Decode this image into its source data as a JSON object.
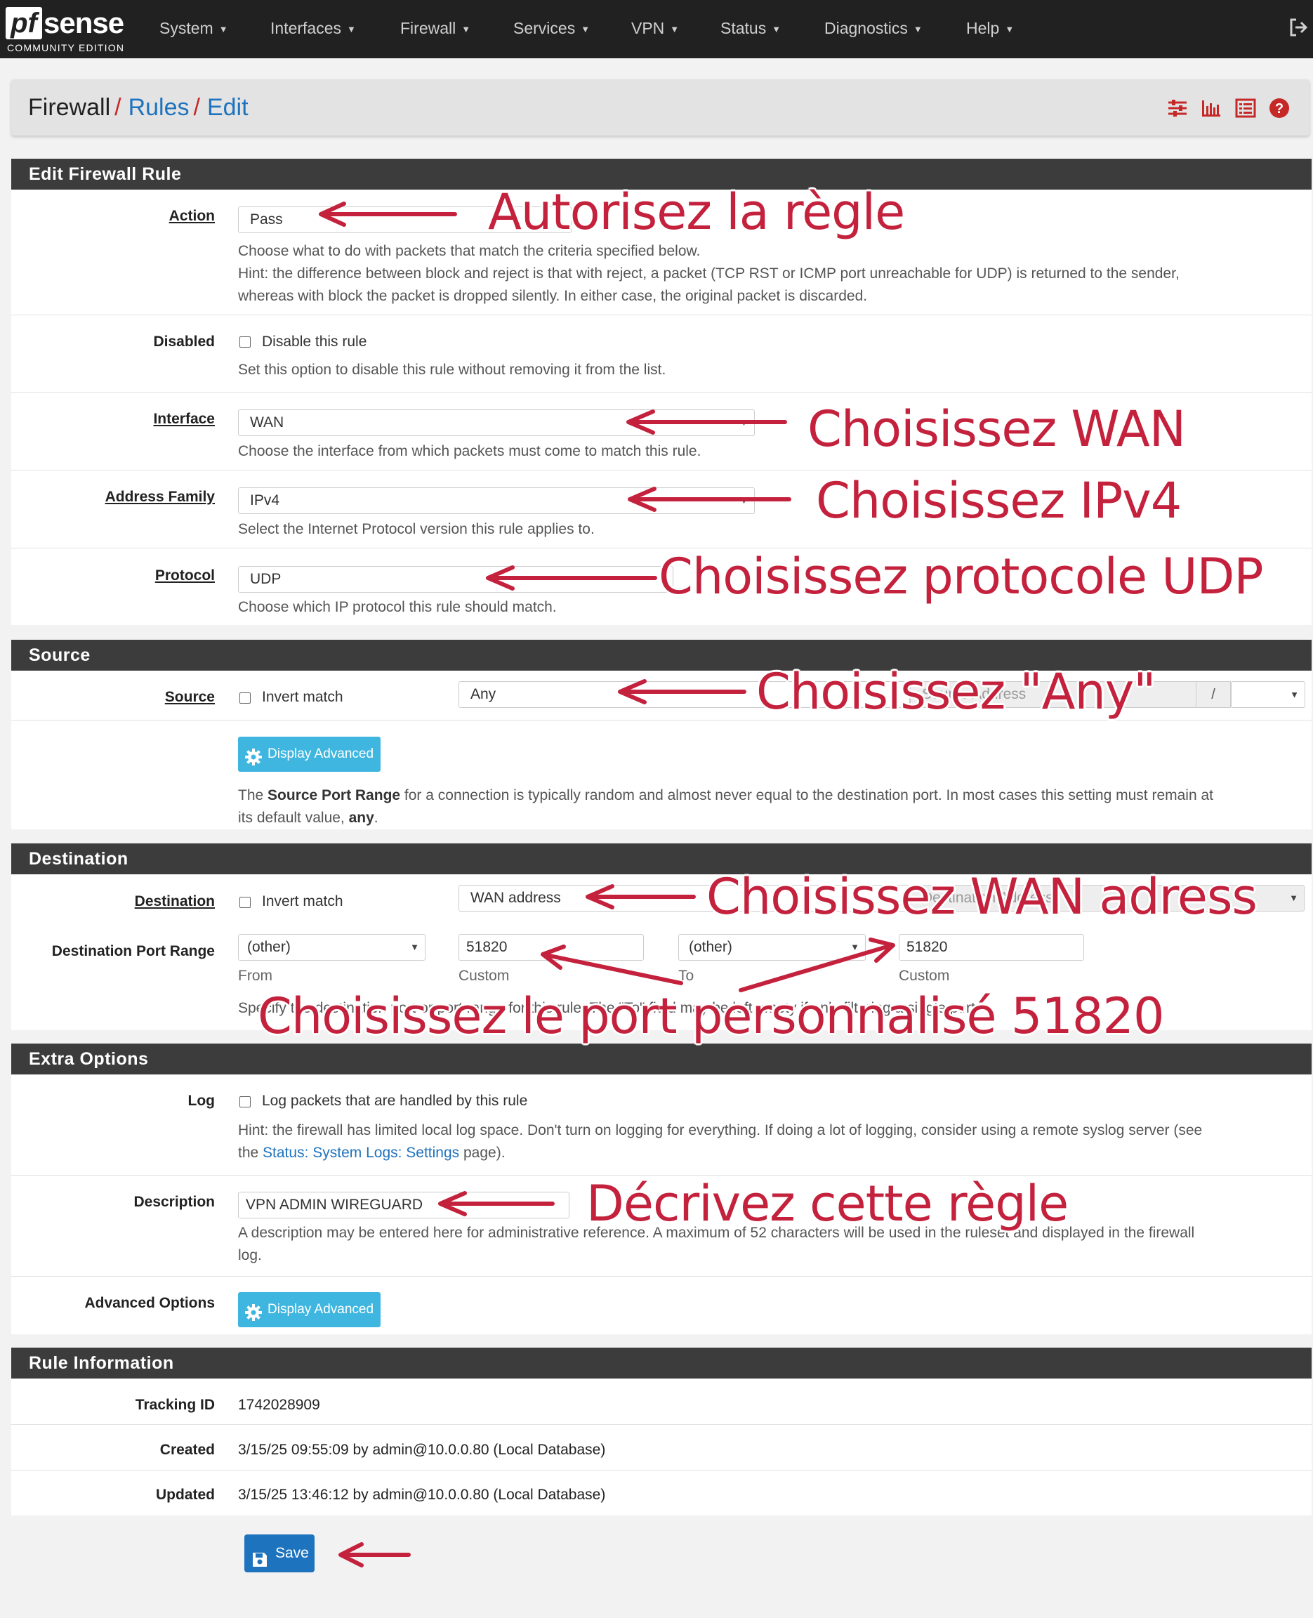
{
  "nav": {
    "logo_main": "pf",
    "logo_sense": "sense",
    "logo_edition": "COMMUNITY EDITION",
    "items": [
      {
        "label": "System"
      },
      {
        "label": "Interfaces"
      },
      {
        "label": "Firewall"
      },
      {
        "label": "Services"
      },
      {
        "label": "VPN"
      },
      {
        "label": "Status"
      },
      {
        "label": "Diagnostics"
      },
      {
        "label": "Help"
      }
    ],
    "logout_icon": "sign-out-icon"
  },
  "breadcrumb": {
    "items": [
      "Firewall",
      "Rules",
      "Edit"
    ],
    "separator": "/",
    "icons": [
      "sliders-icon",
      "bar-chart-icon",
      "list-icon",
      "question-circle-icon"
    ]
  },
  "sections": {
    "edit_rule": "Edit Firewall Rule",
    "source": "Source",
    "destination": "Destination",
    "extra": "Extra Options",
    "info": "Rule Information"
  },
  "action": {
    "label": "Action",
    "value": "Pass",
    "help1": "Choose what to do with packets that match the criteria specified below.",
    "help2": "Hint: the difference between block and reject is that with reject, a packet (TCP RST or ICMP port unreachable for UDP) is returned to the sender,",
    "help3": "whereas with block the packet is dropped silently. In either case, the original packet is discarded."
  },
  "disabled": {
    "label": "Disabled",
    "checkbox_label": "Disable this rule",
    "help": "Set this option to disable this rule without removing it from the list."
  },
  "interface": {
    "label": "Interface",
    "value": "WAN",
    "help": "Choose the interface from which packets must come to match this rule."
  },
  "address_family": {
    "label": "Address Family",
    "value": "IPv4",
    "help": "Select the Internet Protocol version this rule applies to."
  },
  "protocol": {
    "label": "Protocol",
    "value": "UDP",
    "help": "Choose which IP protocol this rule should match."
  },
  "source": {
    "label": "Source",
    "invert_label": "Invert match",
    "type_value": "Any",
    "address_placeholder": "Source Address",
    "slash": "/",
    "advanced_button": "Display Advanced",
    "help_pre": "The ",
    "help_bold": "Source Port Range",
    "help_mid": " for a connection is typically random and almost never equal to the destination port. In most cases this setting must remain at",
    "help_line2_pre": "its default value, ",
    "help_line2_bold": "any",
    "help_line2_post": "."
  },
  "destination": {
    "label": "Destination",
    "invert_label": "Invert match",
    "type_value": "WAN address",
    "address_placeholder": "Destination Address",
    "port_range_label": "Destination Port Range",
    "from_select": "(other)",
    "from_custom": "51820",
    "to_select": "(other)",
    "to_custom": "51820",
    "from_label": "From",
    "custom_label": "Custom",
    "to_label": "To",
    "help": "Specify the destination port or port range for this rule. The \"To\" field may be left empty if only filtering a single port."
  },
  "log": {
    "label": "Log",
    "checkbox_label": "Log packets that are handled by this rule",
    "help1": "Hint: the firewall has limited local log space. Don't turn on logging for everything. If doing a lot of logging, consider using a remote syslog server (see",
    "help2_pre": "the ",
    "help2_link": "Status: System Logs: Settings",
    "help2_post": " page)."
  },
  "description": {
    "label": "Description",
    "value": "VPN ADMIN WIREGUARD",
    "help1": "A description may be entered here for administrative reference. A maximum of 52 characters will be used in the ruleset and displayed in the firewall",
    "help2": "log."
  },
  "advanced_options": {
    "label": "Advanced Options",
    "button": "Display Advanced"
  },
  "rule_info": {
    "tracking_label": "Tracking ID",
    "tracking_value": "1742028909",
    "created_label": "Created",
    "created_value": "3/15/25 09:55:09 by admin@10.0.0.80 (Local Database)",
    "updated_label": "Updated",
    "updated_value": "3/15/25 13:46:12 by admin@10.0.0.80 (Local Database)"
  },
  "save_button": "Save",
  "annotations": {
    "action": "Autorisez la règle",
    "interface": "Choisissez WAN",
    "family": "Choisissez IPv4",
    "protocol": "Choisissez protocole UDP",
    "source": "Choisissez \"Any\"",
    "destination": "Choisissez WAN adress",
    "port": "Choisissez le port personnalisé 51820",
    "description": "Décrivez cette règle"
  },
  "colors": {
    "annotation": "#c4213d",
    "navbar": "#212121",
    "section_heading": "#3c3c3c",
    "link": "#1e73be",
    "advanced_button": "#3fb6df",
    "save_button": "#1e73be"
  }
}
